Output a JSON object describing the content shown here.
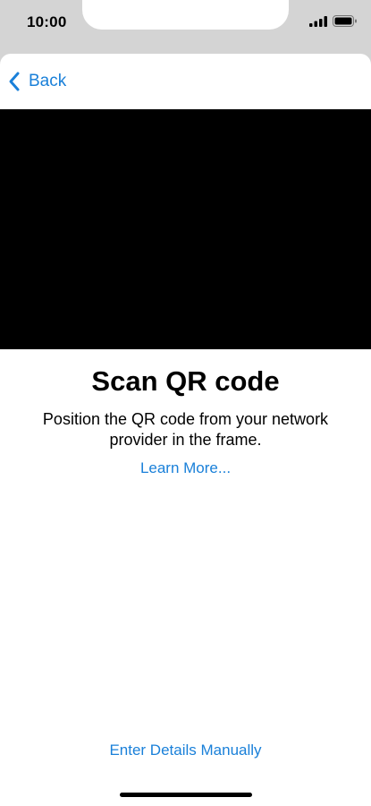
{
  "status_bar": {
    "time": "10:00"
  },
  "nav": {
    "back_label": "Back"
  },
  "scan": {
    "title": "Scan QR code",
    "description": "Position the QR code from your network provider in the frame.",
    "learn_more": "Learn More..."
  },
  "footer": {
    "manual_label": "Enter Details Manually"
  },
  "colors": {
    "accent": "#1a80d9",
    "camera_bg": "#000000",
    "status_bg": "#d4d4d4"
  },
  "icons": {
    "back": "chevron-left-icon",
    "signal": "cellular-signal-icon",
    "battery": "battery-icon"
  }
}
